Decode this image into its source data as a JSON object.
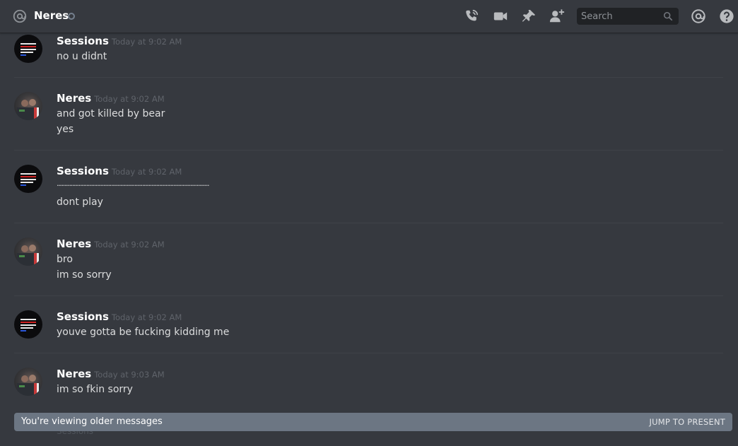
{
  "header": {
    "channel_name": "Neres",
    "search_placeholder": "Search",
    "icons": [
      "at-icon",
      "call-icon",
      "video-icon",
      "pin-icon",
      "add-friend-icon",
      "search-icon",
      "mentions-icon",
      "help-icon"
    ]
  },
  "messages": [
    {
      "author": "Sessions",
      "avatar": "sessions",
      "timestamp": "Today at 9:02 AM",
      "lines": [
        "no u didnt"
      ]
    },
    {
      "author": "Neres",
      "avatar": "neres",
      "timestamp": "Today at 9:02 AM",
      "lines": [
        "and got killed by bear",
        "yes"
      ]
    },
    {
      "author": "Sessions",
      "avatar": "sessions",
      "timestamp": "Today at 9:02 AM",
      "lines": [
        "..................................................................................................",
        "dont play"
      ]
    },
    {
      "author": "Neres",
      "avatar": "neres",
      "timestamp": "Today at 9:02 AM",
      "lines": [
        "bro",
        "im so sorry"
      ]
    },
    {
      "author": "Sessions",
      "avatar": "sessions",
      "timestamp": "Today at 9:02 AM",
      "lines": [
        "youve gotta be fucking kidding me"
      ]
    },
    {
      "author": "Neres",
      "avatar": "neres",
      "timestamp": "Today at 9:03 AM",
      "lines": [
        "im so fkin sorry"
      ]
    }
  ],
  "older_bar": {
    "text": "You're viewing older messages",
    "jump_label": "JUMP TO PRESENT"
  },
  "peek_author": "Sessions",
  "colors": {
    "background": "#36393f",
    "header_text": "#ffffff",
    "timestamp": "#5f636a",
    "older_bar": "#6c7683"
  }
}
